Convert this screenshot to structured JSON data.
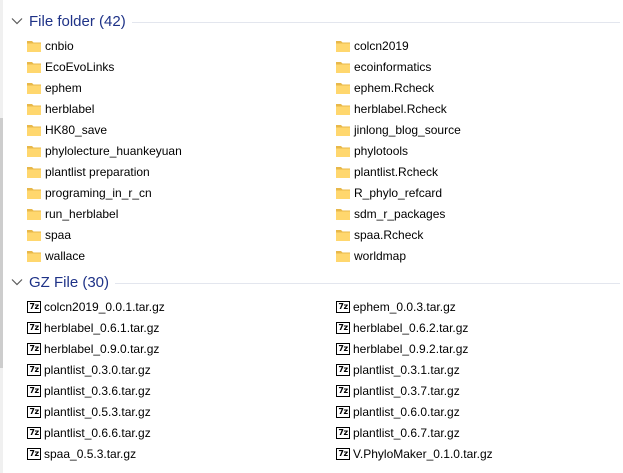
{
  "groups": [
    {
      "title": "File folder (42)",
      "icon": "folder-icon",
      "items": [
        "cnbio",
        "colcn2019",
        "EcoEvoLinks",
        "ecoinformatics",
        "ephem",
        "ephem.Rcheck",
        "herblabel",
        "herblabel.Rcheck",
        "HK80_save",
        "jinlong_blog_source",
        "phylolecture_huankeyuan",
        "phylotools",
        "plantlist preparation",
        "plantlist.Rcheck",
        "programing_in_r_cn",
        "R_phylo_refcard",
        "run_herblabel",
        "sdm_r_packages",
        "spaa",
        "spaa.Rcheck",
        "wallace",
        "worldmap"
      ]
    },
    {
      "title": "GZ File (30)",
      "icon": "7z-archive-icon",
      "icon_glyph": "7z",
      "items": [
        "colcn2019_0.0.1.tar.gz",
        "ephem_0.0.3.tar.gz",
        "herblabel_0.6.1.tar.gz",
        "herblabel_0.6.2.tar.gz",
        "herblabel_0.9.0.tar.gz",
        "herblabel_0.9.2.tar.gz",
        "plantlist_0.3.0.tar.gz",
        "plantlist_0.3.1.tar.gz",
        "plantlist_0.3.6.tar.gz",
        "plantlist_0.3.7.tar.gz",
        "plantlist_0.5.3.tar.gz",
        "plantlist_0.6.0.tar.gz",
        "plantlist_0.6.6.tar.gz",
        "plantlist_0.6.7.tar.gz",
        "spaa_0.5.3.tar.gz",
        "V.PhyloMaker_0.1.0.tar.gz"
      ]
    }
  ],
  "colors": {
    "group_title": "#1e3287",
    "folder_fill": "#ffd76e",
    "folder_tab": "#e8b84a",
    "divider": "#e3e6ee"
  }
}
